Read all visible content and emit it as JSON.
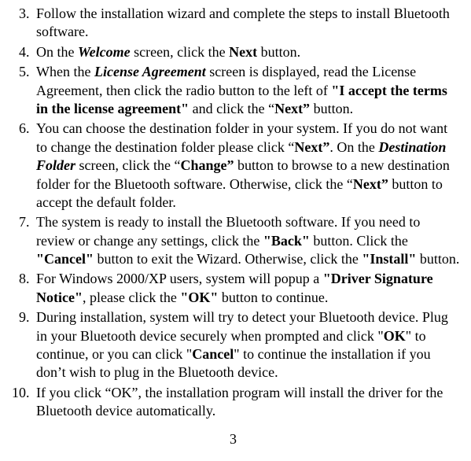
{
  "list": {
    "start": 3,
    "items": [
      "Follow the installation wizard and complete the steps to install Bluetooth software.",
      "On the <b><i>Welcome</i></b> screen, click the <b>Next</b> button.",
      "When the <b><i>License Agreement</i></b> screen is displayed, read the License Agreement, then click the radio button to the left of <b>&quot;I accept the terms in the license agreement&quot;</b> and click the &ldquo;<b>Next&rdquo;</b> button.",
      "You can choose the destination folder in your system. If you do not want to change the destination folder please click &ldquo;<b>Next&rdquo;</b>. On the <b><i>Destination Folder</i></b> screen, click the &ldquo;<b>Change&rdquo;</b> button to browse to a new destination folder for the Bluetooth software. Otherwise, click the &ldquo;<b>Next&rdquo;</b> button to accept the default folder.",
      "The system is ready to install the Bluetooth software. If you need to review or change any settings, click the <b>&quot;Back&quot;</b> button. Click the <b>&quot;Cancel&quot;</b> button to exit the Wizard. Otherwise, click the <b>&quot;Install&quot;</b> button.",
      "For Windows 2000/XP users, system will popup a <b>&quot;Driver Signature Notice&quot;</b>, please click the <b>&quot;OK&quot;</b> button to continue.",
      "During installation, system will try to detect your Bluetooth device. Plug in your Bluetooth device securely when prompted and click &quot;<b>OK</b>&quot; to continue, or you can click &quot;<b>Cancel</b>&quot; to continue the installation if you don&rsquo;t wish to plug in the Bluetooth device.",
      "If you click &ldquo;OK&rdquo;, the installation program will install the driver for the Bluetooth device automatically."
    ]
  },
  "page_number": "3"
}
